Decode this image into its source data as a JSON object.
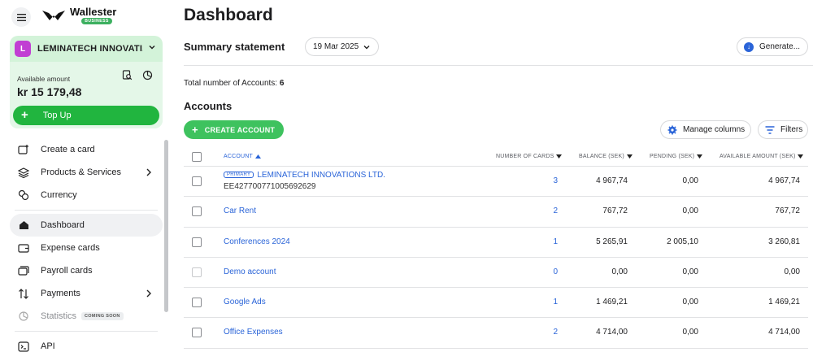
{
  "brand": {
    "name": "Wallester",
    "badge": "BUSINESS"
  },
  "account_card": {
    "avatar_letter": "L",
    "name": "LEMINATECH INNOVATI...",
    "available_label": "Available amount",
    "available_amount": "kr 15 179,48",
    "topup_label": "Top Up"
  },
  "nav": {
    "create_card": "Create a card",
    "products": "Products & Services",
    "currency": "Currency",
    "dashboard": "Dashboard",
    "expense_cards": "Expense cards",
    "payroll_cards": "Payroll cards",
    "payments": "Payments",
    "statistics": "Statistics",
    "coming_soon": "COMING SOON",
    "api": "API"
  },
  "main": {
    "title": "Dashboard",
    "summary_title": "Summary statement",
    "date": "19 Mar 2025",
    "generate": "Generate...",
    "total_label": "Total number of Accounts:",
    "total_value": "6",
    "accounts_title": "Accounts",
    "create_account": "CREATE ACCOUNT",
    "manage_columns": "Manage columns",
    "filters": "Filters"
  },
  "table": {
    "headers": {
      "account": "ACCOUNT",
      "cards": "NUMBER OF CARDS",
      "balance": "BALANCE (SEK)",
      "pending": "PENDING (SEK)",
      "available": "AVAILABLE AMOUNT (SEK)"
    },
    "rows": [
      {
        "badge": "PRIMARY",
        "name": "LEMINATECH INNOVATIONS LTD.",
        "iban": "EE427700771005692629",
        "cards": "3",
        "balance": "4 967,74",
        "pending": "0,00",
        "available": "4 967,74"
      },
      {
        "name": "Car Rent",
        "cards": "2",
        "balance": "767,72",
        "pending": "0,00",
        "available": "767,72"
      },
      {
        "name": "Conferences 2024",
        "cards": "1",
        "balance": "5 265,91",
        "pending": "2 005,10",
        "available": "3 260,81"
      },
      {
        "name": "Demo account",
        "cards": "0",
        "balance": "0,00",
        "pending": "0,00",
        "available": "0,00"
      },
      {
        "name": "Google Ads",
        "cards": "1",
        "balance": "1 469,21",
        "pending": "0,00",
        "available": "1 469,21"
      },
      {
        "name": "Office Expenses",
        "cards": "2",
        "balance": "4 714,00",
        "pending": "0,00",
        "available": "4 714,00"
      }
    ]
  }
}
